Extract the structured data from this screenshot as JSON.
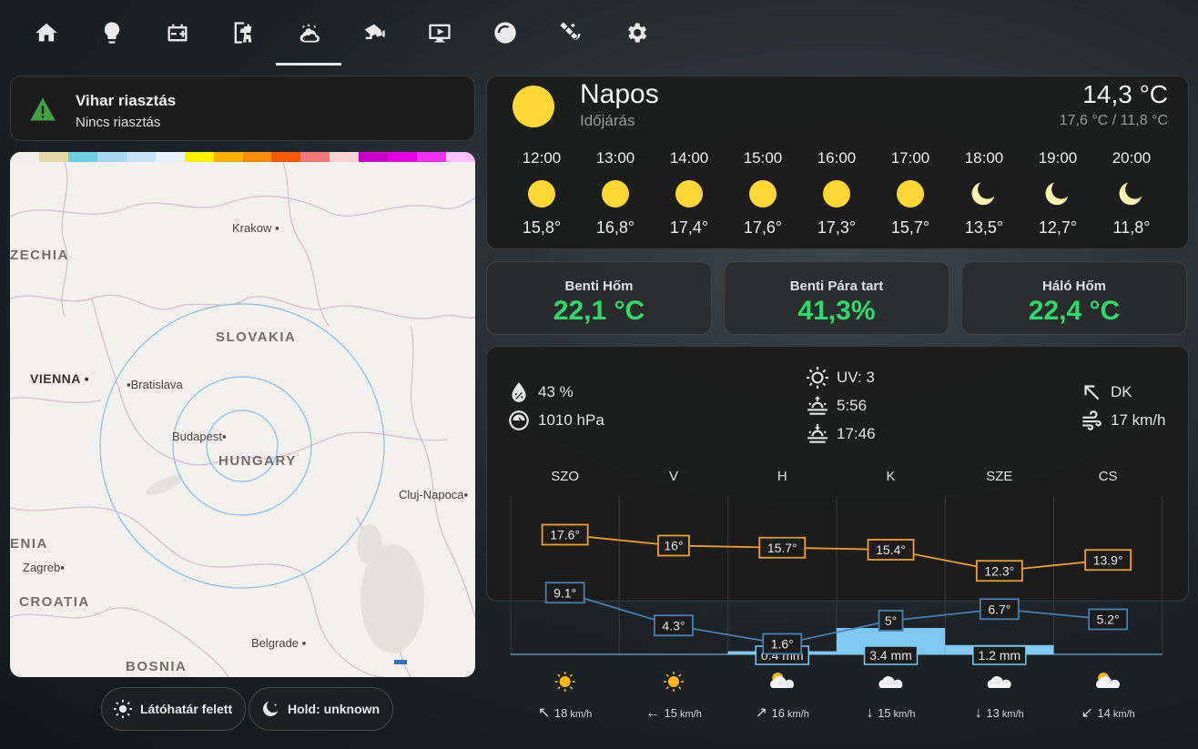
{
  "nav": {
    "tabs": [
      {
        "name": "home-icon"
      },
      {
        "name": "lightbulb-icon"
      },
      {
        "name": "battery-icon"
      },
      {
        "name": "solar-panel-icon"
      },
      {
        "name": "weather-night-icon",
        "active": true
      },
      {
        "name": "cctv-icon"
      },
      {
        "name": "television-icon"
      },
      {
        "name": "speedometer-icon"
      },
      {
        "name": "satellite-icon"
      },
      {
        "name": "gear-icon"
      }
    ]
  },
  "alert": {
    "title": "Vihar riasztás",
    "status": "Nincs riasztás",
    "icon": "warning-icon",
    "color": "#43a047"
  },
  "map": {
    "legend_colors": [
      "#f0efe8",
      "#e3d9a8",
      "#70cde0",
      "#a8d8f0",
      "#c6e2f7",
      "#e7f1fb",
      "#fff200",
      "#fbb003",
      "#f78d0a",
      "#f55b06",
      "#f07878",
      "#f9d2d2",
      "#c800c8",
      "#e000e0",
      "#f030f0",
      "#f9c0f9"
    ],
    "labels": {
      "krakow": "Krakow",
      "czechia": "ZECHIA",
      "slovakia": "SLOVAKIA",
      "vienna": "VIENNA",
      "bratislava": "Bratislava",
      "budapest": "Budapest",
      "hungary": "HUNGARY",
      "cluj": "Cluj-Napoca",
      "slovenia": "ENIA",
      "zagreb": "Zagreb",
      "croatia": "CROATIA",
      "belgrade": "Belgrade",
      "bosnia": "BOSNIA"
    }
  },
  "chips": {
    "sun": {
      "label": "Látóhatár felett",
      "icon": "sun-icon"
    },
    "moon": {
      "label": "Hold: unknown",
      "icon": "moon-icon"
    }
  },
  "weather": {
    "condition": "Napos",
    "subtitle": "Időjárás",
    "temp_now": "14,3 °C",
    "hilo": "17,6 °C / 11,8 °C",
    "hourly": [
      {
        "time": "12:00",
        "icon": "sun",
        "temp": "15,8°"
      },
      {
        "time": "13:00",
        "icon": "sun",
        "temp": "16,8°"
      },
      {
        "time": "14:00",
        "icon": "sun",
        "temp": "17,4°"
      },
      {
        "time": "15:00",
        "icon": "sun",
        "temp": "17,6°"
      },
      {
        "time": "16:00",
        "icon": "sun",
        "temp": "17,3°"
      },
      {
        "time": "17:00",
        "icon": "sun",
        "temp": "15,7°"
      },
      {
        "time": "18:00",
        "icon": "moon",
        "temp": "13,5°"
      },
      {
        "time": "19:00",
        "icon": "moon",
        "temp": "12,7°"
      },
      {
        "time": "20:00",
        "icon": "moon",
        "temp": "11,8°"
      }
    ]
  },
  "sensors": [
    {
      "name": "Benti Hőm",
      "value": "22,1 °C"
    },
    {
      "name": "Benti Pára tart",
      "value": "41,3%"
    },
    {
      "name": "Háló Hőm",
      "value": "22,4 °C"
    }
  ],
  "stats": {
    "humidity": "43 %",
    "pressure": "1010 hPa",
    "uv": "UV: 3",
    "sunrise": "5:56",
    "sunset": "17:46",
    "wind_dir": "DK",
    "wind_speed": "17 km/h"
  },
  "chart_data": {
    "type": "line",
    "categories": [
      "SZO",
      "V",
      "H",
      "K",
      "SZE",
      "CS"
    ],
    "series": [
      {
        "values": [
          17.6,
          16,
          15.7,
          15.4,
          12.3,
          13.9
        ],
        "labels": [
          "17.6°",
          "16°",
          "15.7°",
          "15.4°",
          "12.3°",
          "13.9°"
        ],
        "color": "#f0a02a"
      },
      {
        "values": [
          9.1,
          4.3,
          1.6,
          5,
          6.7,
          5.2
        ],
        "labels": [
          "9.1°",
          "4.3°",
          "1.6°",
          "5°",
          "6.7°",
          "5.2°"
        ],
        "color": "#4a7fb0"
      }
    ],
    "precipitation": {
      "values": [
        0,
        0,
        0.4,
        3.4,
        1.2,
        0
      ],
      "labels": [
        "",
        "",
        "0.4 mm",
        "3.4 mm",
        "1.2 mm",
        ""
      ],
      "color": "#7ec8f2"
    },
    "day_icons": [
      "sun",
      "sun",
      "partly-cloudy",
      "cloudy",
      "cloudy",
      "partly-cloudy"
    ],
    "wind": [
      {
        "arrow": "↖",
        "speed": "18",
        "unit": "km/h"
      },
      {
        "arrow": "←",
        "speed": "15",
        "unit": "km/h"
      },
      {
        "arrow": "↗",
        "speed": "16",
        "unit": "km/h"
      },
      {
        "arrow": "↓",
        "speed": "15",
        "unit": "km/h"
      },
      {
        "arrow": "↓",
        "speed": "13",
        "unit": "km/h"
      },
      {
        "arrow": "↙",
        "speed": "14",
        "unit": "km/h"
      }
    ]
  }
}
